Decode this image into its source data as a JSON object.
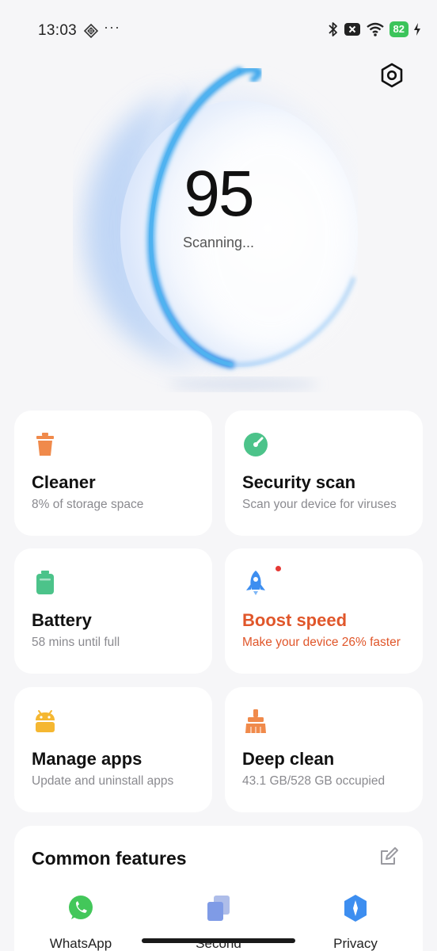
{
  "status_bar": {
    "time": "13:03",
    "diamond_icon": "diamond-grid-icon",
    "overflow": "···",
    "icons": [
      "bluetooth-icon",
      "x-box-icon",
      "wifi-icon",
      "battery-icon",
      "charging-icon"
    ],
    "battery_level": "82"
  },
  "header": {
    "settings_icon": "hexagon-settings-icon"
  },
  "score": {
    "value": "95",
    "status": "Scanning..."
  },
  "cards": [
    {
      "title": "Cleaner",
      "subtitle": "8% of storage space",
      "icon": "trash-icon",
      "color": "#f08a4b"
    },
    {
      "title": "Security scan",
      "subtitle": "Scan your device for viruses",
      "icon": "shield-scan-icon",
      "color": "#4cc38a"
    },
    {
      "title": "Battery",
      "subtitle": "58 mins until full",
      "icon": "battery-icon",
      "color": "#4cc38a"
    },
    {
      "title": "Boost speed",
      "subtitle": "Make your device 26% faster",
      "icon": "rocket-icon",
      "color": "#3d8ef0",
      "accent": "#e0562a"
    },
    {
      "title": "Manage apps",
      "subtitle": "Update and uninstall apps",
      "icon": "android-icon",
      "color": "#f5b731"
    },
    {
      "title": "Deep clean",
      "subtitle": "43.1 GB/528 GB occupied",
      "icon": "broom-icon",
      "color": "#f08a4b"
    }
  ],
  "common_features": {
    "title": "Common features",
    "edit_icon": "edit-icon",
    "items": [
      {
        "label": "WhatsApp",
        "icon": "whatsapp-icon",
        "color": "#43c75a"
      },
      {
        "label": "Second",
        "icon": "second-space-icon",
        "color": "#7f9be6"
      },
      {
        "label": "Privacy",
        "icon": "privacy-icon",
        "color": "#3d8ef0"
      }
    ]
  }
}
